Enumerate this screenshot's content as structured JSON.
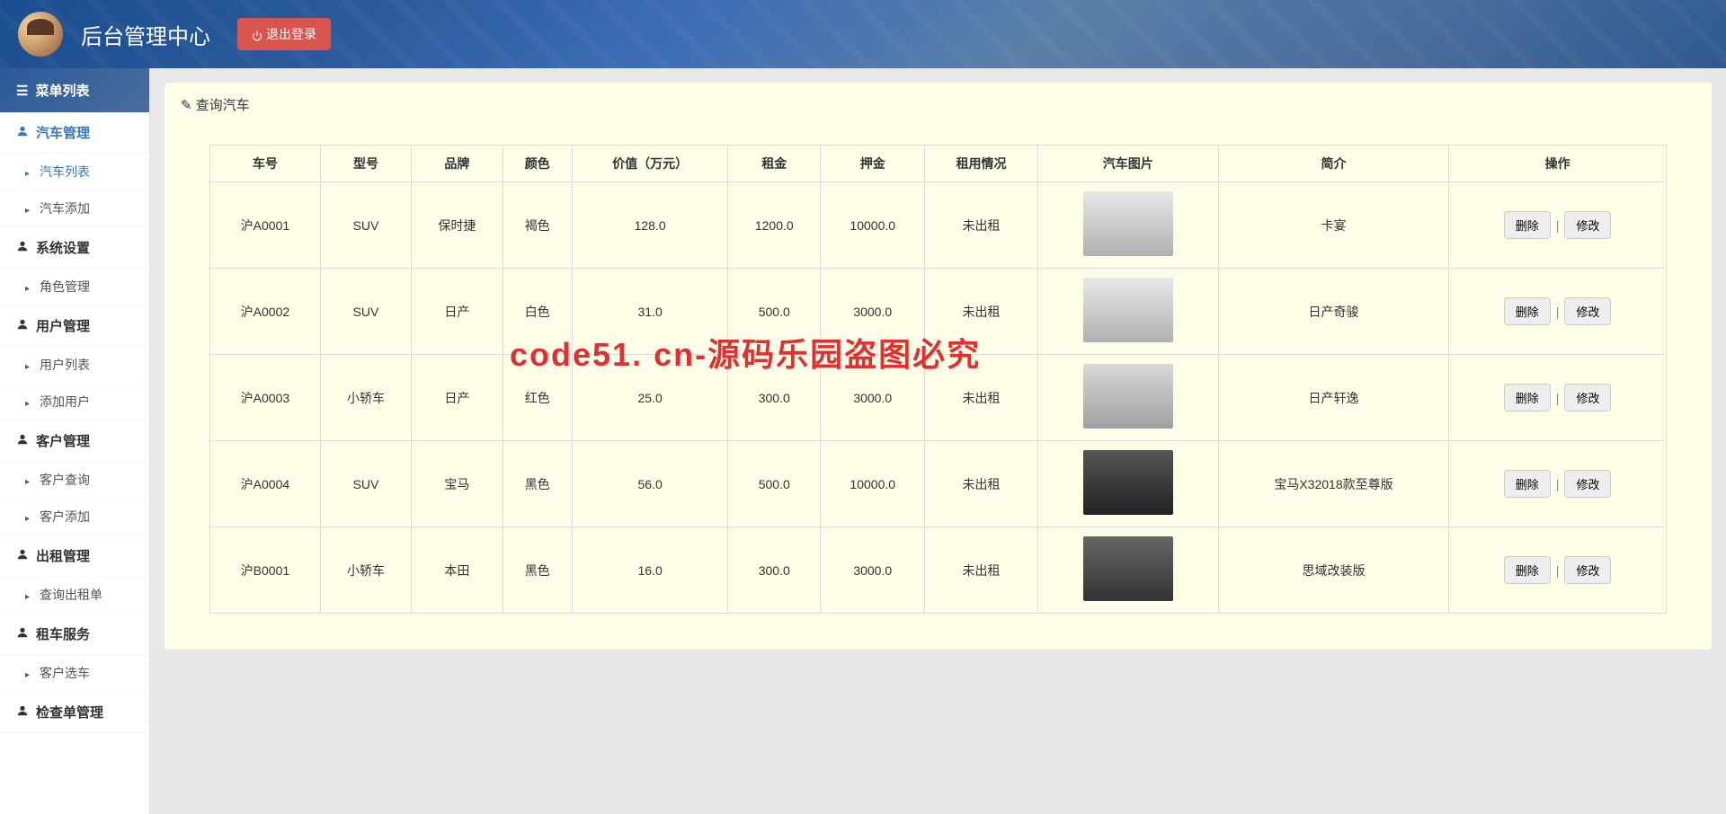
{
  "header": {
    "title": "后台管理中心",
    "logout": "退出登录"
  },
  "sidebar": {
    "header": "菜单列表",
    "groups": [
      {
        "label": "汽车管理",
        "active": true,
        "items": [
          {
            "label": "汽车列表",
            "active": true
          },
          {
            "label": "汽车添加",
            "active": false
          }
        ]
      },
      {
        "label": "系统设置",
        "active": false,
        "items": [
          {
            "label": "角色管理",
            "active": false
          }
        ]
      },
      {
        "label": "用户管理",
        "active": false,
        "items": [
          {
            "label": "用户列表",
            "active": false
          },
          {
            "label": "添加用户",
            "active": false
          }
        ]
      },
      {
        "label": "客户管理",
        "active": false,
        "items": [
          {
            "label": "客户查询",
            "active": false
          },
          {
            "label": "客户添加",
            "active": false
          }
        ]
      },
      {
        "label": "出租管理",
        "active": false,
        "items": [
          {
            "label": "查询出租单",
            "active": false
          }
        ]
      },
      {
        "label": "租车服务",
        "active": false,
        "items": [
          {
            "label": "客户选车",
            "active": false
          }
        ]
      },
      {
        "label": "检查单管理",
        "active": false,
        "items": []
      }
    ]
  },
  "panel": {
    "title": "查询汽车"
  },
  "table": {
    "headers": [
      "车号",
      "型号",
      "品牌",
      "颜色",
      "价值（万元）",
      "租金",
      "押金",
      "租用情况",
      "汽车图片",
      "简介",
      "操作"
    ],
    "rows": [
      {
        "plate": "沪A0001",
        "type": "SUV",
        "brand": "保时捷",
        "color": "褐色",
        "value": "128.0",
        "rent": "1200.0",
        "deposit": "10000.0",
        "status": "未出租",
        "img": "silver",
        "desc": "卡宴"
      },
      {
        "plate": "沪A0002",
        "type": "SUV",
        "brand": "日产",
        "color": "白色",
        "value": "31.0",
        "rent": "500.0",
        "deposit": "3000.0",
        "status": "未出租",
        "img": "silver",
        "desc": "日产奇骏"
      },
      {
        "plate": "沪A0003",
        "type": "小轿车",
        "brand": "日产",
        "color": "红色",
        "value": "25.0",
        "rent": "300.0",
        "deposit": "3000.0",
        "status": "未出租",
        "img": "red",
        "desc": "日产轩逸"
      },
      {
        "plate": "沪A0004",
        "type": "SUV",
        "brand": "宝马",
        "color": "黑色",
        "value": "56.0",
        "rent": "500.0",
        "deposit": "10000.0",
        "status": "未出租",
        "img": "black",
        "desc": "宝马X32018款至尊版"
      },
      {
        "plate": "沪B0001",
        "type": "小轿车",
        "brand": "本田",
        "color": "黑色",
        "value": "16.0",
        "rent": "300.0",
        "deposit": "3000.0",
        "status": "未出租",
        "img": "dark",
        "desc": "思域改装版"
      }
    ],
    "actions": {
      "delete": "删除",
      "edit": "修改",
      "sep": "|"
    }
  },
  "watermark": "code51. cn-源码乐园盗图必究"
}
